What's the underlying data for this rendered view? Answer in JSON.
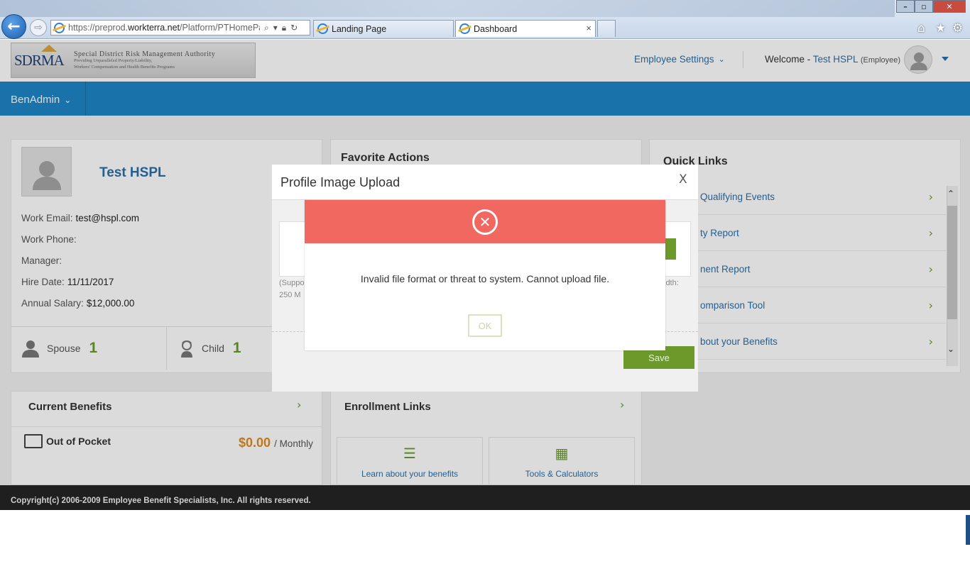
{
  "browser": {
    "url_host": "https://preprod.",
    "url_domain": "workterra.net",
    "url_path": "/Platform/PTHomePa",
    "tabs": [
      {
        "label": "Landing Page"
      },
      {
        "label": "Dashboard"
      }
    ],
    "back_glyph": "←",
    "forward_glyph": "⇨",
    "close_tab_glyph": "×",
    "window_close_glyph": "✕"
  },
  "header": {
    "logo_mark": "SDRMA",
    "logo_title": "Special District Risk Management Authority",
    "logo_sub1": "Providing Unparalleled Property/Liability,",
    "logo_sub2": "Workers' Compensation and Health Benefits Programs",
    "employee_settings": "Employee Settings",
    "welcome_prefix": "Welcome -",
    "user_name": "Test HSPL",
    "user_role": "(Employee)"
  },
  "nav": {
    "benadmin": "BenAdmin"
  },
  "profile": {
    "name": "Test HSPL",
    "work_email_label": "Work Email:",
    "work_email": "test@hspl.com",
    "work_phone_label": "Work Phone:",
    "work_phone": "",
    "manager_label": "Manager:",
    "manager": "",
    "hire_date_label": "Hire Date:",
    "hire_date": "11/11/2017",
    "salary_label": "Annual Salary:",
    "salary": "$12,000.00",
    "spouse_label": "Spouse",
    "spouse_count": "1",
    "child_label": "Child",
    "child_count": "1"
  },
  "favorite_actions": {
    "title": "Favorite Actions"
  },
  "quick_links": {
    "title": "Quick Links",
    "items": [
      {
        "label": "Qualifying Events"
      },
      {
        "label": "ty Report"
      },
      {
        "label": "nent Report"
      },
      {
        "label": "omparison Tool"
      },
      {
        "label": "bout your Benefits"
      }
    ]
  },
  "current_benefits": {
    "title": "Current Benefits",
    "out_of_pocket_label": "Out of Pocket",
    "amount": "$0.00",
    "period": "/ Monthly"
  },
  "enrollment_links": {
    "title": "Enrollment Links",
    "learn": "Learn about your benefits",
    "tools": "Tools & Calculators"
  },
  "footer": {
    "copyright": "Copyright(c) 2006-2009 Employee Benefit Specialists, Inc. All rights reserved."
  },
  "upload_modal": {
    "title": "Profile Image Upload",
    "close": "X",
    "note1": "(Suppo",
    "note2": "250 M",
    "note3": "idth:",
    "save": "Save"
  },
  "error_dialog": {
    "message": "Invalid file format or threat to system. Cannot upload file.",
    "ok": "OK",
    "icon_glyph": "✕"
  },
  "colors": {
    "nav_blue": "#1e86c6",
    "link_blue": "#2a6faa",
    "accent_green": "#6b9a2a",
    "error_red": "#f0685f",
    "amount_orange": "#e08a1e"
  }
}
